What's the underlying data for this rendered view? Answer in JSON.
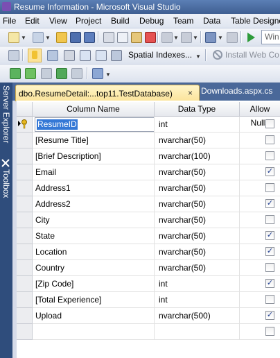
{
  "window": {
    "title": "Resume Information - Microsoft Visual Studio"
  },
  "menu": [
    "File",
    "Edit",
    "View",
    "Project",
    "Build",
    "Debug",
    "Team",
    "Data",
    "Table Designer"
  ],
  "toolbar2": {
    "spatial_indexes": "Spatial Indexes...",
    "install_web": "Install Web Co"
  },
  "toolbar1": {
    "combo_text": "Win"
  },
  "side_tabs": {
    "server_explorer": "Server Explorer",
    "toolbox": "Toolbox"
  },
  "tabs": {
    "active": "dbo.ResumeDetail:...top11.TestDatabase)",
    "active_close": "×",
    "inactive": "Downloads.aspx.cs"
  },
  "table": {
    "headers": {
      "column_name": "Column Name",
      "data_type": "Data Type",
      "allow_nulls": "Allow Nulls"
    },
    "rows": [
      {
        "name": "ResumeID",
        "type": "int",
        "nulls": false,
        "key": true
      },
      {
        "name": "[Resume Title]",
        "type": "nvarchar(50)",
        "nulls": false
      },
      {
        "name": "[Brief Description]",
        "type": "nvarchar(100)",
        "nulls": false
      },
      {
        "name": "Email",
        "type": "nvarchar(50)",
        "nulls": true
      },
      {
        "name": "Address1",
        "type": "nvarchar(50)",
        "nulls": false
      },
      {
        "name": "Address2",
        "type": "nvarchar(50)",
        "nulls": true
      },
      {
        "name": "City",
        "type": "nvarchar(50)",
        "nulls": false
      },
      {
        "name": "State",
        "type": "nvarchar(50)",
        "nulls": true
      },
      {
        "name": "Location",
        "type": "nvarchar(50)",
        "nulls": true
      },
      {
        "name": "Country",
        "type": "nvarchar(50)",
        "nulls": false
      },
      {
        "name": "[Zip Code]",
        "type": "int",
        "nulls": true
      },
      {
        "name": "[Total Experience]",
        "type": "int",
        "nulls": false
      },
      {
        "name": "Upload",
        "type": "nvarchar(500)",
        "nulls": true
      },
      {
        "name": "",
        "type": "",
        "nulls": false
      }
    ]
  },
  "colors": {
    "title_bar": "#4a6ba3",
    "tab_strip": "#4a6899",
    "active_tab": "#fbe8a6",
    "selection": "#3478d6"
  }
}
